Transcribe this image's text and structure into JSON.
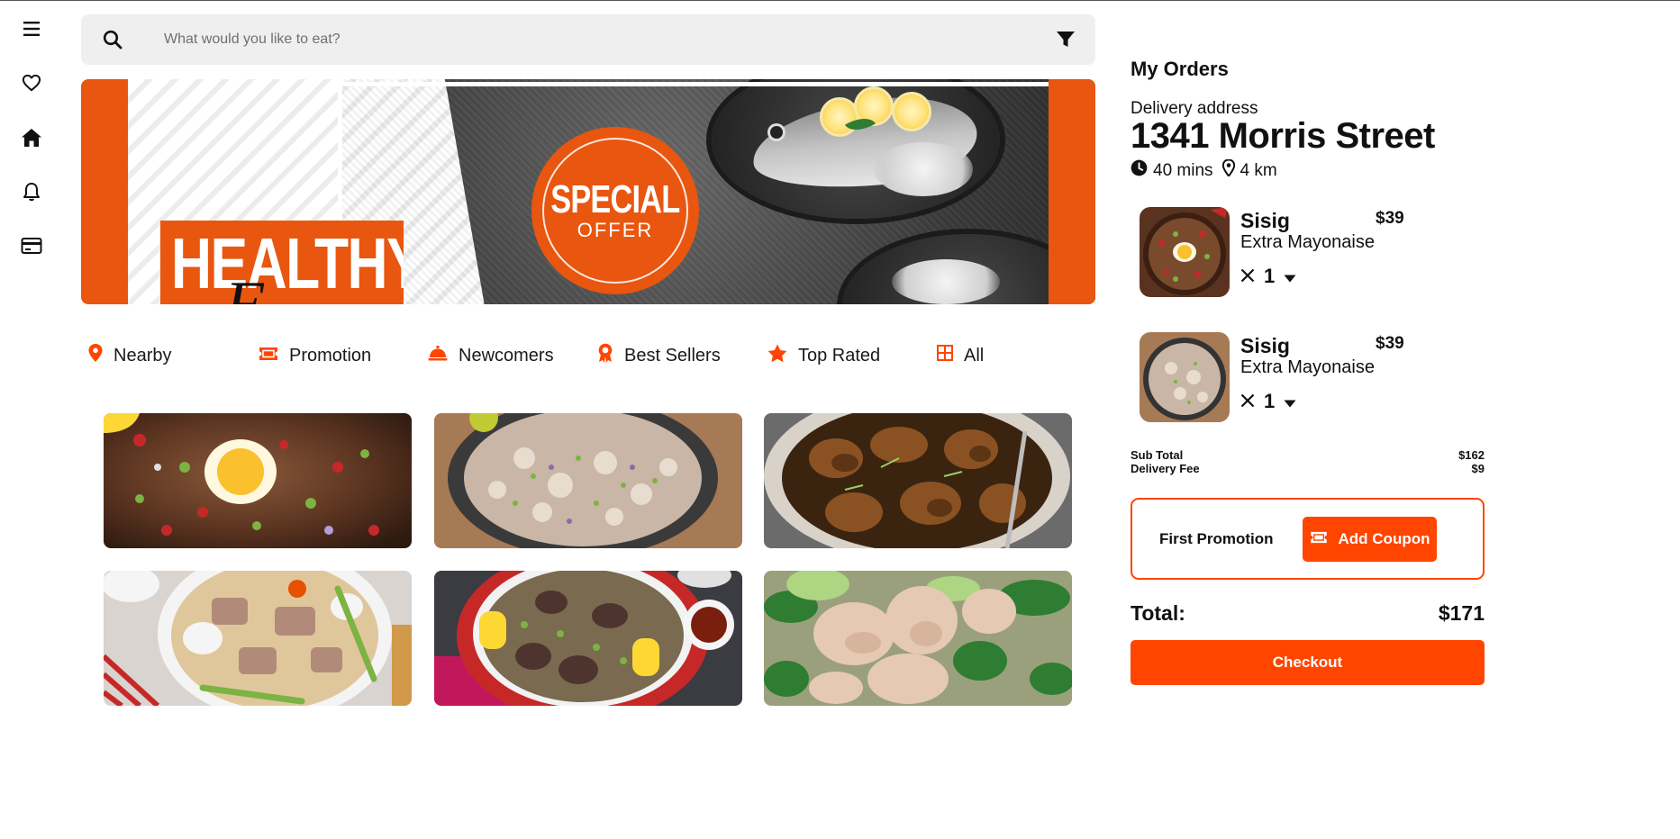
{
  "search": {
    "placeholder": "What would you like to eat?",
    "icon": "search-icon",
    "filter_icon": "filter-icon"
  },
  "sidebar": {
    "items": [
      {
        "icon": "menu-icon"
      },
      {
        "icon": "heart-icon"
      },
      {
        "icon": "home-icon"
      },
      {
        "icon": "bell-icon"
      },
      {
        "icon": "credit-card-icon"
      }
    ]
  },
  "banner": {
    "special_line1": "SPECIAL",
    "special_line2": "OFFER",
    "healthy": "HEALTHY",
    "script_letter": "F"
  },
  "categories": [
    {
      "label": "Nearby",
      "icon": "location-pin-icon"
    },
    {
      "label": "Promotion",
      "icon": "ticket-icon"
    },
    {
      "label": "Newcomers",
      "icon": "service-bell-icon"
    },
    {
      "label": "Best Sellers",
      "icon": "award-icon"
    },
    {
      "label": "Top Rated",
      "icon": "star-icon"
    },
    {
      "label": "All",
      "icon": "grid-icon"
    }
  ],
  "orders": {
    "title": "My Orders",
    "address_label": "Delivery address",
    "address": "1341 Morris Street",
    "time": "40 mins",
    "distance": "4 km",
    "items": [
      {
        "name": "Sisig",
        "price": "$39",
        "option": "Extra Mayonaise",
        "qty": "1"
      },
      {
        "name": "Sisig",
        "price": "$39",
        "option": "Extra Mayonaise",
        "qty": "1"
      }
    ],
    "subtotal_label": "Sub Total",
    "subtotal": "$162",
    "delivery_label": "Delivery Fee",
    "delivery": "$9",
    "promo_label": "First Promotion",
    "coupon_button": "Add Coupon",
    "total_label": "Total:",
    "total": "$171",
    "checkout_button": "Checkout"
  },
  "colors": {
    "accent": "#ff4500",
    "banner_orange": "#e8560f",
    "search_bg": "#efefef"
  }
}
